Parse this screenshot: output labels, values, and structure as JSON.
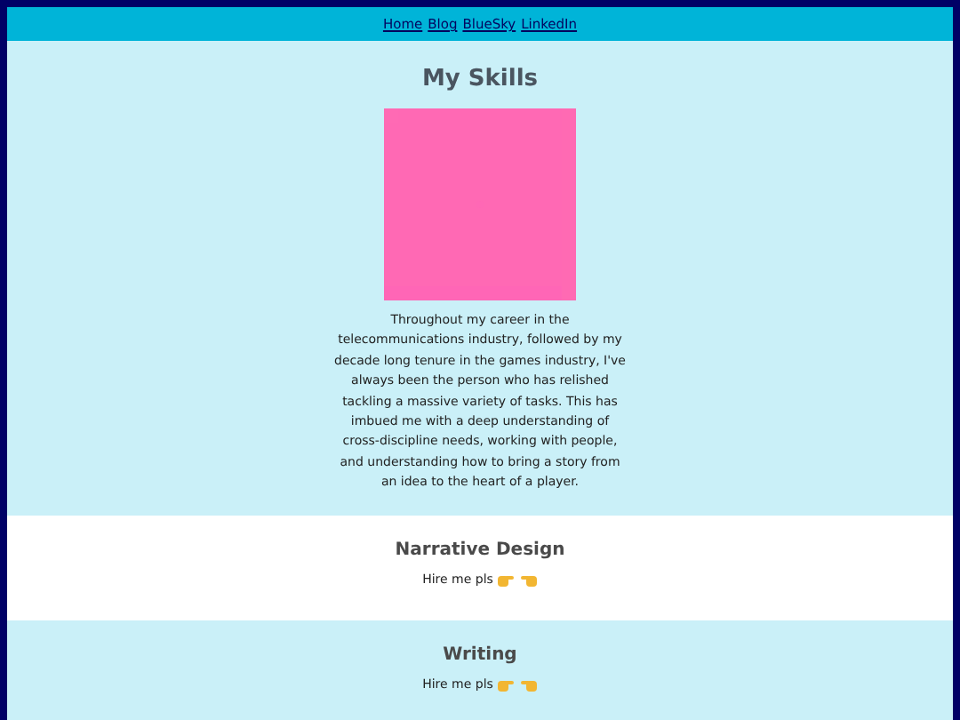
{
  "nav": {
    "links": [
      "Home",
      "Blog",
      "BlueSky",
      "LinkedIn"
    ]
  },
  "intro": {
    "title": "My Skills",
    "text": "Throughout my career in the telecommunications industry, followed by my decade long tenure in the games industry, I've always been the person who has relished tackling a massive variety of tasks. This has imbued me with a deep understanding of cross-discipline needs, working with people, and understanding how to bring a story from an idea to the heart of a player."
  },
  "skills": [
    {
      "title": "Narrative Design",
      "text": "Hire me pls"
    },
    {
      "title": "Writing",
      "text": "Hire me pls"
    }
  ]
}
